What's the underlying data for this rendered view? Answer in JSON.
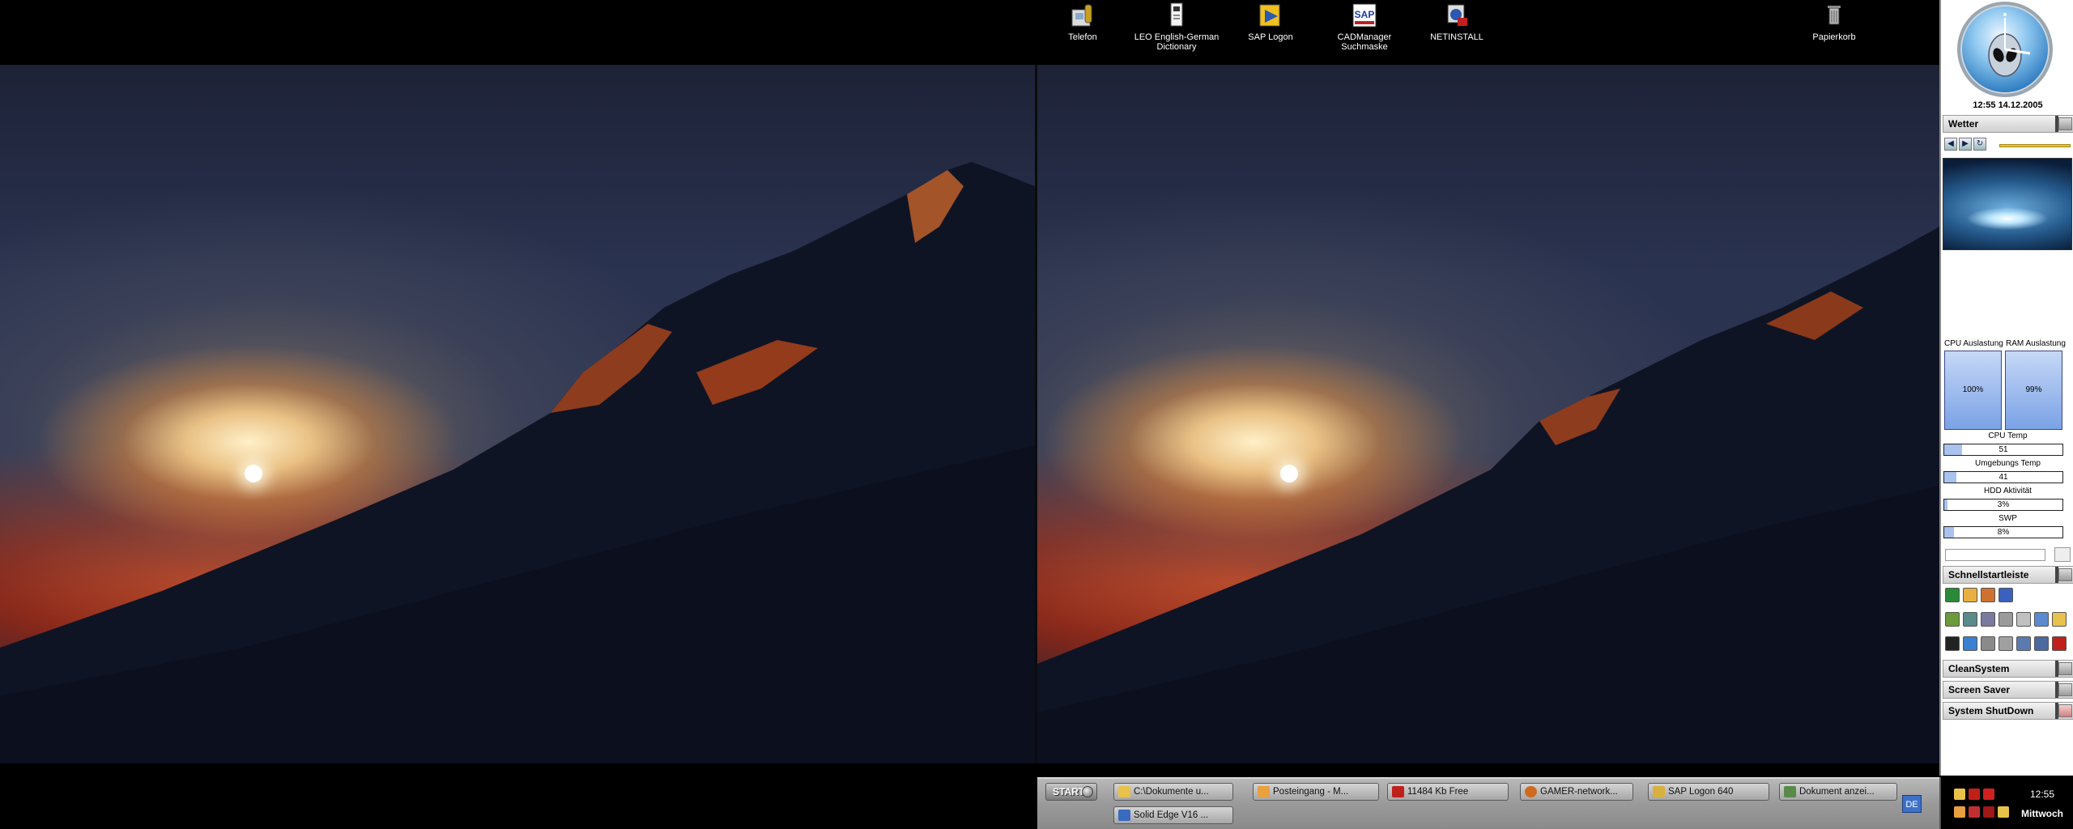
{
  "desktop_icons": [
    {
      "label": "Telefon",
      "icon": "telephone-icon"
    },
    {
      "label": "LEO English-German\nDictionary",
      "icon": "dictionary-icon"
    },
    {
      "label": "SAP Logon",
      "icon": "sap-logon-icon"
    },
    {
      "label": "CADManager\nSuchmaske",
      "icon": "cadmanager-icon"
    },
    {
      "label": "NETINSTALL",
      "icon": "netinstall-icon"
    },
    {
      "label": "Papierkorb",
      "icon": "recycle-bin-icon"
    }
  ],
  "taskbar": {
    "start_label": "START",
    "tasks": [
      {
        "label": "C:\\Dokumente u...",
        "icon": "folder-icon",
        "color": "#e8c24a"
      },
      {
        "label": "Posteingang - M...",
        "icon": "mail-icon",
        "color": "#e8a040"
      },
      {
        "label": "11484 Kb Free",
        "icon": "ram-booster-icon",
        "color": "#c0201a"
      },
      {
        "label": "GAMER-network...",
        "icon": "firefox-icon",
        "color": "#d06a20"
      },
      {
        "label": "SAP Logon 640",
        "icon": "sap-logon-icon",
        "color": "#d8b040"
      },
      {
        "label": "Dokument anzei...",
        "icon": "document-viewer-icon",
        "color": "#5a8a4a"
      },
      {
        "label": "Solid Edge V16 ...",
        "icon": "solid-edge-icon",
        "color": "#3a6ac0"
      }
    ],
    "language": "DE"
  },
  "tray": {
    "time": "12:55",
    "day": "Mittwoch"
  },
  "sidebar": {
    "datetime": "12:55 14.12.2005",
    "weather_title": "Wetter",
    "cpu_label": "CPU Auslastung",
    "ram_label": "RAM Auslastung",
    "cpu_value": "100%",
    "ram_value": "99%",
    "metrics": [
      {
        "label": "CPU Temp",
        "value": "51",
        "level": 0.15
      },
      {
        "label": "Umgebungs Temp",
        "value": "41",
        "level": 0.1
      },
      {
        "label": "HDD Aktivität",
        "value": "3%",
        "level": 0.03
      },
      {
        "label": "SWP",
        "value": "8%",
        "level": 0.08
      }
    ],
    "quicklaunch_title": "Schnellstartleiste",
    "clean_title": "CleanSystem",
    "screensaver_title": "Screen Saver",
    "shutdown_title": "System ShutDown"
  },
  "colors": {
    "accent": "#3d70c8",
    "sidebar_header": "#cfcfcf",
    "taskbar": "#9a9a9a"
  }
}
